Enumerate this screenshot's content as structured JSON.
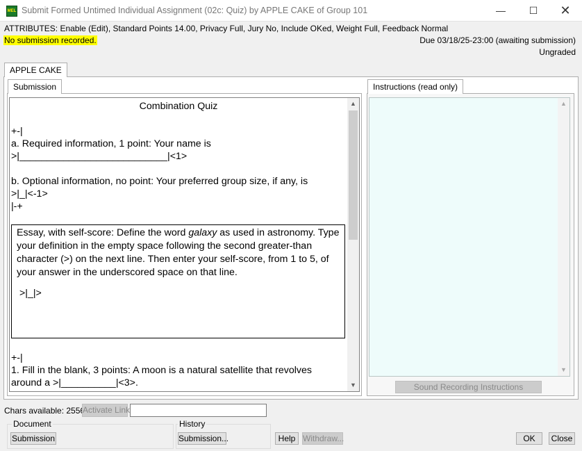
{
  "window": {
    "title": "Submit Formed Untimed Individual Assignment (02c: Quiz) by APPLE CAKE of Group 101",
    "icon": "app-icon",
    "controls": [
      "minimize-icon",
      "maximize-icon",
      "close-icon"
    ]
  },
  "header": {
    "attributes": "ATTRIBUTES: Enable (Edit), Standard Points 14.00, Privacy Full, Jury No, Include OKed, Weight Full, Feedback Normal",
    "status": "No submission recorded.",
    "due": "Due 03/18/25-23:00 (awaiting submission)",
    "grade_state": "Ungraded"
  },
  "outer_tab": "APPLE CAKE",
  "submission_tab": "Submission",
  "instructions_tab": "Instructions (read only)",
  "editor": {
    "title": "Combination Quiz",
    "lines": [
      "+-|",
      "a. Required information, 1 point: Your name is",
      ">|___________________________|<1>",
      "b. Optional information, no point: Your preferred group size, if any, is",
      ">|_|<-1>",
      "|-+"
    ],
    "essay_pre": "Essay, with self-score: Define the word ",
    "essay_italic": "galaxy",
    "essay_post": " as used in astronomy. Type your definition in the empty space following the second greater-than character (>) on the next line. Then enter your self-score, from 1 to 5, of your answer in the underscored space on that line.",
    "essay_answer": ">|_|>",
    "after_lines": [
      "+-|",
      "1. Fill in the blank, 3 points: A moon is a natural satellite that revolves",
      "around a >|__________|<3>."
    ]
  },
  "sound_button": "Sound Recording Instructions",
  "footer": {
    "chars_available": "Chars available: 2556",
    "activate_link": "Activate Link",
    "link_value": "",
    "document_label": "Document",
    "document_button": "Submission",
    "history_label": "History",
    "history_button": "Submission...",
    "help": "Help",
    "withdraw": "Withdraw...",
    "ok": "OK",
    "close": "Close"
  },
  "colors": {
    "status_highlight": "#ffff00",
    "instructions_bg": "#eefcfb",
    "app_icon": "#1a7a2a"
  }
}
